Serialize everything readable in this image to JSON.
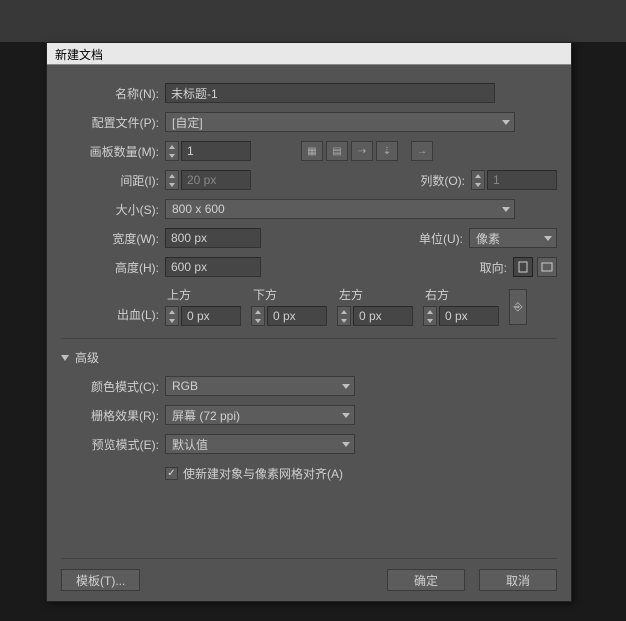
{
  "dialog": {
    "title": "新建文档",
    "name_label": "名称(N):",
    "name_value": "未标题-1",
    "profile_label": "配置文件(P):",
    "profile_value": "[自定]",
    "artboards_label": "画板数量(M):",
    "artboards_value": "1",
    "spacing_label": "间距(I):",
    "spacing_value": "20 px",
    "cols_label": "列数(O):",
    "cols_value": "1",
    "size_label": "大小(S):",
    "size_value": "800 x 600",
    "width_label": "宽度(W):",
    "width_value": "800 px",
    "units_label": "单位(U):",
    "units_value": "像素",
    "height_label": "高度(H):",
    "height_value": "600 px",
    "orient_label": "取向:",
    "bleed_label": "出血(L):",
    "bleed": {
      "top_h": "上方",
      "top_v": "0 px",
      "bot_h": "下方",
      "bot_v": "0 px",
      "left_h": "左方",
      "left_v": "0 px",
      "right_h": "右方",
      "right_v": "0 px"
    },
    "advanced_label": "高级",
    "colormode_label": "颜色模式(C):",
    "colormode_value": "RGB",
    "raster_label": "栅格效果(R):",
    "raster_value": "屏幕 (72 ppi)",
    "preview_label": "预览模式(E):",
    "preview_value": "默认值",
    "align_check_label": "使新建对象与像素网格对齐(A)",
    "template_btn": "模板(T)...",
    "ok_btn": "确定",
    "cancel_btn": "取消"
  }
}
